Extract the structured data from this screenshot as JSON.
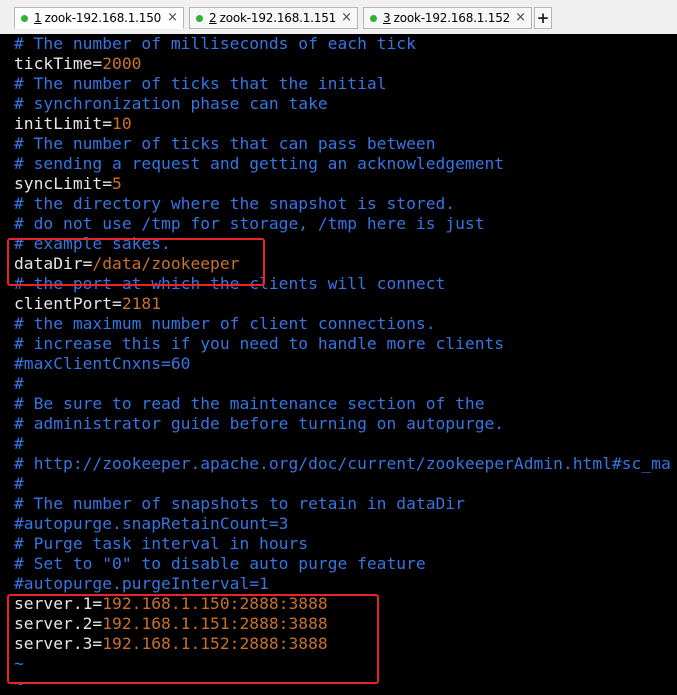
{
  "tabs": [
    {
      "number": "1",
      "label": "zook-192.168.1.150",
      "status_color": "#2db32d",
      "active": true
    },
    {
      "number": "2",
      "label": "zook-192.168.1.151",
      "status_color": "#2db32d",
      "active": false
    },
    {
      "number": "3",
      "label": "zook-192.168.1.152",
      "status_color": "#2db32d",
      "active": false
    }
  ],
  "new_tab_label": "+",
  "close_glyph": "×",
  "colors": {
    "comment": "#3874e0",
    "plain": "#e6e6e6",
    "value": "#c7722c",
    "highlight": "#e8232a"
  },
  "terminal": {
    "lines": [
      {
        "type": "comment",
        "text": "# The number of milliseconds of each tick"
      },
      {
        "type": "kv",
        "key": "tickTime=",
        "value": "2000"
      },
      {
        "type": "comment",
        "text": "# The number of ticks that the initial"
      },
      {
        "type": "comment",
        "text": "# synchronization phase can take"
      },
      {
        "type": "kv",
        "key": "initLimit=",
        "value": "10"
      },
      {
        "type": "comment",
        "text": "# The number of ticks that can pass between"
      },
      {
        "type": "comment",
        "text": "# sending a request and getting an acknowledgement"
      },
      {
        "type": "kv",
        "key": "syncLimit=",
        "value": "5"
      },
      {
        "type": "comment",
        "text": "# the directory where the snapshot is stored."
      },
      {
        "type": "comment",
        "text": "# do not use /tmp for storage, /tmp here is just"
      },
      {
        "type": "comment",
        "text": "# example sakes."
      },
      {
        "type": "kv",
        "key": "dataDir=",
        "value": "/data/zookeeper"
      },
      {
        "type": "comment",
        "text": "# the port at which the clients will connect"
      },
      {
        "type": "kv",
        "key": "clientPort=",
        "value": "2181"
      },
      {
        "type": "comment",
        "text": "# the maximum number of client connections."
      },
      {
        "type": "comment",
        "text": "# increase this if you need to handle more clients"
      },
      {
        "type": "comment",
        "text": "#maxClientCnxns=60"
      },
      {
        "type": "comment",
        "text": "#"
      },
      {
        "type": "comment",
        "text": "# Be sure to read the maintenance section of the"
      },
      {
        "type": "comment",
        "text": "# administrator guide before turning on autopurge."
      },
      {
        "type": "comment",
        "text": "#"
      },
      {
        "type": "comment",
        "text": "# http://zookeeper.apache.org/doc/current/zookeeperAdmin.html#sc_ma"
      },
      {
        "type": "comment",
        "text": "#"
      },
      {
        "type": "comment",
        "text": "# The number of snapshots to retain in dataDir"
      },
      {
        "type": "comment",
        "text": "#autopurge.snapRetainCount=3"
      },
      {
        "type": "comment",
        "text": "# Purge task interval in hours"
      },
      {
        "type": "comment",
        "text": "# Set to \"0\" to disable auto purge feature"
      },
      {
        "type": "comment",
        "text": "#autopurge.purgeInterval=1"
      },
      {
        "type": "kv",
        "key": "server.1=",
        "value": "192.168.1.150:2888:3888"
      },
      {
        "type": "kv",
        "key": "server.2=",
        "value": "192.168.1.151:2888:3888"
      },
      {
        "type": "kv",
        "key": "server.3=",
        "value": "192.168.1.152:2888:3888"
      },
      {
        "type": "tilde",
        "text": "~"
      },
      {
        "type": "tilde",
        "text": "~"
      }
    ]
  }
}
